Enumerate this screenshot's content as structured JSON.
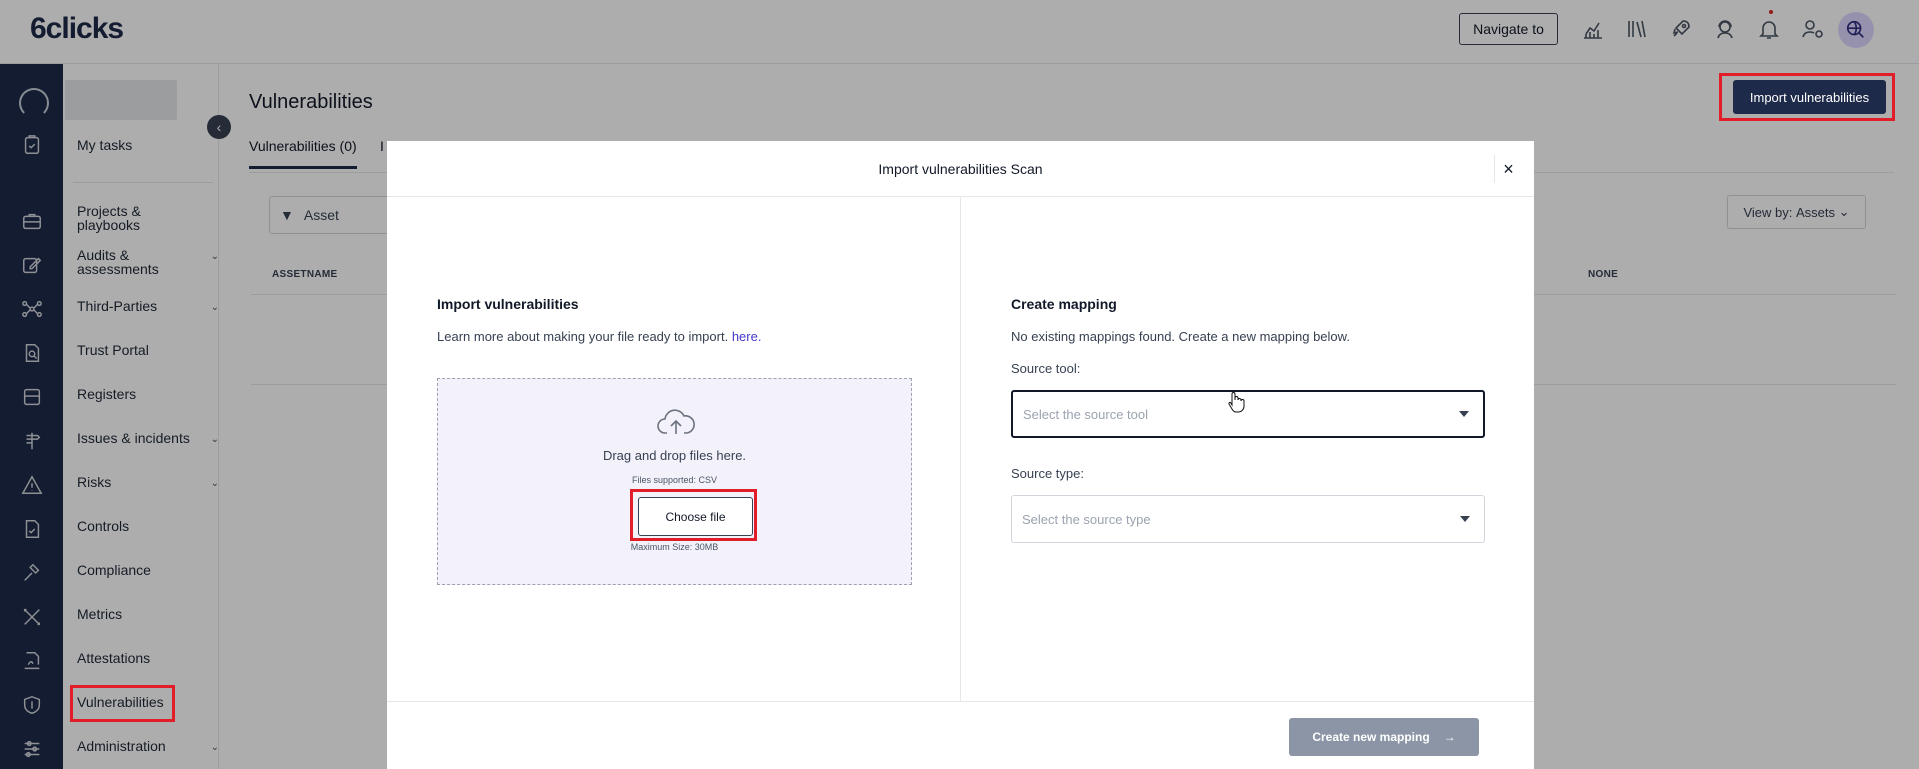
{
  "app": {
    "logo_text": "6clicks"
  },
  "topbar": {
    "navigate_label": "Navigate to",
    "icons": [
      "analytics-icon",
      "library-icon",
      "rocket-icon",
      "support-agent-icon",
      "bell-icon",
      "user-settings-icon"
    ],
    "avatar_icon": "global-search-icon"
  },
  "sidebar": {
    "items": [
      {
        "label": "My tasks",
        "icon": "clipboard-check-icon",
        "has_children": false
      },
      {
        "label": "Projects & playbooks",
        "icon": "briefcase-icon",
        "has_children": false
      },
      {
        "label": "Audits & assessments",
        "icon": "edit-icon",
        "has_children": true
      },
      {
        "label": "Third-Parties",
        "icon": "network-icon",
        "has_children": true
      },
      {
        "label": "Trust Portal",
        "icon": "document-search-icon",
        "has_children": false
      },
      {
        "label": "Registers",
        "icon": "inbox-icon",
        "has_children": false
      },
      {
        "label": "Issues & incidents",
        "icon": "signpost-icon",
        "has_children": true
      },
      {
        "label": "Risks",
        "icon": "warning-icon",
        "has_children": true
      },
      {
        "label": "Controls",
        "icon": "file-check-icon",
        "has_children": false
      },
      {
        "label": "Compliance",
        "icon": "gavel-icon",
        "has_children": false
      },
      {
        "label": "Metrics",
        "icon": "tools-icon",
        "has_children": false
      },
      {
        "label": "Attestations",
        "icon": "signature-icon",
        "has_children": false
      },
      {
        "label": "Vulnerabilities",
        "icon": "shield-icon",
        "has_children": false
      },
      {
        "label": "Administration",
        "icon": "sliders-icon",
        "has_children": true
      }
    ]
  },
  "main": {
    "title": "Vulnerabilities",
    "import_button": "Import vulnerabilities",
    "tabs": [
      {
        "label": "Vulnerabilities (0)"
      },
      {
        "label": "I"
      }
    ],
    "filter_label": "Asset",
    "view_by_label": "View by:",
    "view_by_value": "Assets",
    "columns": [
      "ASSETNAME",
      "NONE"
    ]
  },
  "modal": {
    "title": "Import vulnerabilities Scan",
    "close_label": "×",
    "left": {
      "heading": "Import vulnerabilities",
      "help_text": "Learn more about making your file ready to import.",
      "help_link": "here.",
      "drag_text": "Drag and drop files here.",
      "files_supported": "Files supported: CSV",
      "choose_file": "Choose file",
      "max_size": "Maximum Size: 30MB"
    },
    "right": {
      "heading": "Create mapping",
      "info_text": "No existing mappings found. Create a new mapping below.",
      "source_tool_label": "Source tool:",
      "source_tool_placeholder": "Select the source tool",
      "source_type_label": "Source type:",
      "source_type_placeholder": "Select the source type"
    },
    "create_button": "Create new mapping"
  },
  "colors": {
    "brand_navy": "#1e2a4a",
    "highlight_red": "#e11d2a",
    "link": "#4338ca"
  }
}
